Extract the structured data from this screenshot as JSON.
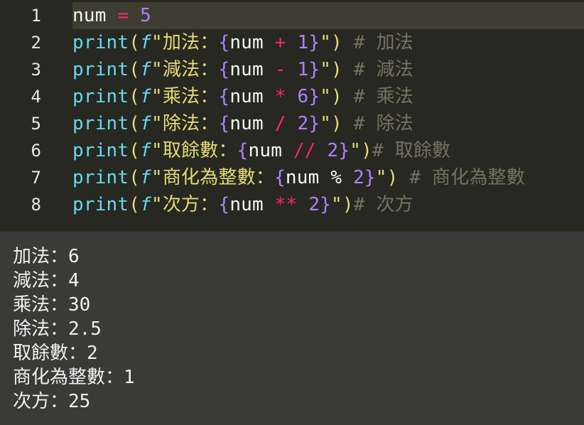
{
  "editor": {
    "current_line": 1,
    "lines": [
      {
        "num": "1",
        "tokens": [
          {
            "t": "num",
            "c": "t-var"
          },
          {
            "t": " ",
            "c": ""
          },
          {
            "t": "=",
            "c": "t-op"
          },
          {
            "t": " ",
            "c": ""
          },
          {
            "t": "5",
            "c": "t-num"
          }
        ]
      },
      {
        "num": "2",
        "tokens": [
          {
            "t": "print",
            "c": "t-fn"
          },
          {
            "t": "(",
            "c": "t-str"
          },
          {
            "t": "f",
            "c": "t-fpre"
          },
          {
            "t": "\"加法：",
            "c": "t-str"
          },
          {
            "t": "{",
            "c": "t-brace"
          },
          {
            "t": "num",
            "c": "t-var"
          },
          {
            "t": " ",
            "c": ""
          },
          {
            "t": "+",
            "c": "t-op"
          },
          {
            "t": " ",
            "c": ""
          },
          {
            "t": "1",
            "c": "t-num"
          },
          {
            "t": "}",
            "c": "t-brace"
          },
          {
            "t": "\")",
            "c": "t-str"
          },
          {
            "t": " # 加法",
            "c": "t-cm"
          }
        ]
      },
      {
        "num": "3",
        "tokens": [
          {
            "t": "print",
            "c": "t-fn"
          },
          {
            "t": "(",
            "c": "t-str"
          },
          {
            "t": "f",
            "c": "t-fpre"
          },
          {
            "t": "\"減法：",
            "c": "t-str"
          },
          {
            "t": "{",
            "c": "t-brace"
          },
          {
            "t": "num",
            "c": "t-var"
          },
          {
            "t": " ",
            "c": ""
          },
          {
            "t": "-",
            "c": "t-op"
          },
          {
            "t": " ",
            "c": ""
          },
          {
            "t": "1",
            "c": "t-num"
          },
          {
            "t": "}",
            "c": "t-brace"
          },
          {
            "t": "\")",
            "c": "t-str"
          },
          {
            "t": " # 減法",
            "c": "t-cm"
          }
        ]
      },
      {
        "num": "4",
        "tokens": [
          {
            "t": "print",
            "c": "t-fn"
          },
          {
            "t": "(",
            "c": "t-str"
          },
          {
            "t": "f",
            "c": "t-fpre"
          },
          {
            "t": "\"乘法：",
            "c": "t-str"
          },
          {
            "t": "{",
            "c": "t-brace"
          },
          {
            "t": "num",
            "c": "t-var"
          },
          {
            "t": " ",
            "c": ""
          },
          {
            "t": "*",
            "c": "t-op"
          },
          {
            "t": " ",
            "c": ""
          },
          {
            "t": "6",
            "c": "t-num"
          },
          {
            "t": "}",
            "c": "t-brace"
          },
          {
            "t": "\")",
            "c": "t-str"
          },
          {
            "t": " # 乘法",
            "c": "t-cm"
          }
        ]
      },
      {
        "num": "5",
        "tokens": [
          {
            "t": "print",
            "c": "t-fn"
          },
          {
            "t": "(",
            "c": "t-str"
          },
          {
            "t": "f",
            "c": "t-fpre"
          },
          {
            "t": "\"除法：",
            "c": "t-str"
          },
          {
            "t": "{",
            "c": "t-brace"
          },
          {
            "t": "num",
            "c": "t-var"
          },
          {
            "t": " ",
            "c": ""
          },
          {
            "t": "/",
            "c": "t-op"
          },
          {
            "t": " ",
            "c": ""
          },
          {
            "t": "2",
            "c": "t-num"
          },
          {
            "t": "}",
            "c": "t-brace"
          },
          {
            "t": "\")",
            "c": "t-str"
          },
          {
            "t": " # 除法",
            "c": "t-cm"
          }
        ]
      },
      {
        "num": "6",
        "tokens": [
          {
            "t": "print",
            "c": "t-fn"
          },
          {
            "t": "(",
            "c": "t-str"
          },
          {
            "t": "f",
            "c": "t-fpre"
          },
          {
            "t": "\"取餘數：",
            "c": "t-str"
          },
          {
            "t": "{",
            "c": "t-brace"
          },
          {
            "t": "num",
            "c": "t-var"
          },
          {
            "t": " ",
            "c": ""
          },
          {
            "t": "//",
            "c": "t-op"
          },
          {
            "t": " ",
            "c": ""
          },
          {
            "t": "2",
            "c": "t-num"
          },
          {
            "t": "}",
            "c": "t-brace"
          },
          {
            "t": "\")",
            "c": "t-str"
          },
          {
            "t": "# 取餘數",
            "c": "t-cm"
          }
        ]
      },
      {
        "num": "7",
        "tokens": [
          {
            "t": "print",
            "c": "t-fn"
          },
          {
            "t": "(",
            "c": "t-str"
          },
          {
            "t": "f",
            "c": "t-fpre"
          },
          {
            "t": "\"商化為整數：",
            "c": "t-str"
          },
          {
            "t": "{",
            "c": "t-brace"
          },
          {
            "t": "num",
            "c": "t-var"
          },
          {
            "t": " % ",
            "c": "t-cn"
          },
          {
            "t": "2",
            "c": "t-num"
          },
          {
            "t": "}",
            "c": "t-brace"
          },
          {
            "t": "\")",
            "c": "t-str"
          },
          {
            "t": " # 商化為整數",
            "c": "t-cm"
          }
        ]
      },
      {
        "num": "8",
        "tokens": [
          {
            "t": "print",
            "c": "t-fn"
          },
          {
            "t": "(",
            "c": "t-str"
          },
          {
            "t": "f",
            "c": "t-fpre"
          },
          {
            "t": "\"次方：",
            "c": "t-str"
          },
          {
            "t": "{",
            "c": "t-brace"
          },
          {
            "t": "num",
            "c": "t-var"
          },
          {
            "t": " ",
            "c": ""
          },
          {
            "t": "**",
            "c": "t-op"
          },
          {
            "t": " ",
            "c": ""
          },
          {
            "t": "2",
            "c": "t-num"
          },
          {
            "t": "}",
            "c": "t-brace"
          },
          {
            "t": "\")",
            "c": "t-str"
          },
          {
            "t": "# 次方",
            "c": "t-cm"
          }
        ]
      }
    ]
  },
  "output": {
    "lines": [
      "加法：6",
      "減法：4",
      "乘法：30",
      "除法：2.5",
      "取餘數：2",
      "商化為整數：1",
      "次方：25"
    ]
  },
  "colors": {
    "editor_bg": "#272822",
    "current_line_bg": "#3e3d32",
    "output_bg": "#3a3a38",
    "function": "#66d9ef",
    "string": "#e6db74",
    "number": "#ae81ff",
    "operator": "#f92672",
    "comment": "#75715e"
  }
}
